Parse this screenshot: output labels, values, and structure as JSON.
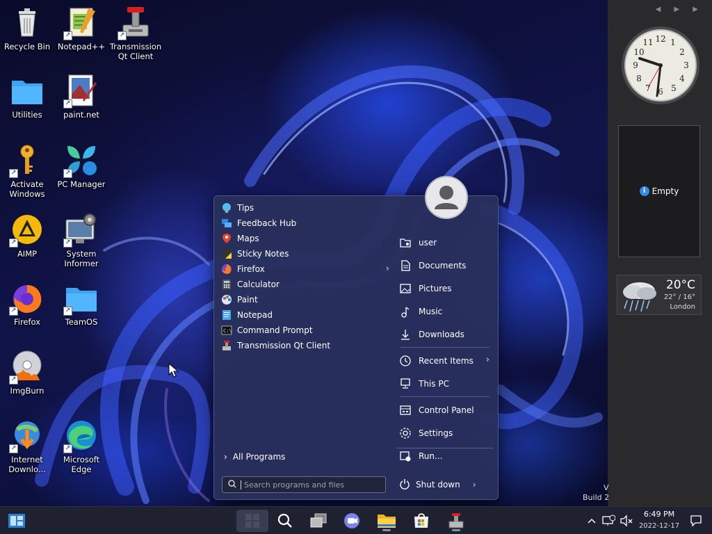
{
  "desktop_icons": [
    {
      "id": "recycle-bin",
      "label": "Recycle Bin",
      "shortcut": false
    },
    {
      "id": "notepadpp",
      "label": "Notepad++",
      "shortcut": true
    },
    {
      "id": "transmission",
      "label": "Transmission\nQt Client",
      "shortcut": true
    },
    {
      "id": "utilities",
      "label": "Utilities",
      "shortcut": false
    },
    {
      "id": "paintnet",
      "label": "paint.net",
      "shortcut": true
    },
    {
      "id": "activate-windows",
      "label": "Activate\nWindows",
      "shortcut": true
    },
    {
      "id": "pc-manager",
      "label": "PC Manager",
      "shortcut": true
    },
    {
      "id": "aimp",
      "label": "AIMP",
      "shortcut": true
    },
    {
      "id": "system-informer",
      "label": "System\nInformer",
      "shortcut": true
    },
    {
      "id": "firefox",
      "label": "Firefox",
      "shortcut": true
    },
    {
      "id": "teamos",
      "label": "TeamOS",
      "shortcut": true
    },
    {
      "id": "imgburn",
      "label": "ImgBurn",
      "shortcut": true
    },
    {
      "id": "internet-download",
      "label": "Internet\nDownlo...",
      "shortcut": true
    },
    {
      "id": "microsoft-edge",
      "label": "Microsoft\nEdge",
      "shortcut": true
    }
  ],
  "start_menu": {
    "programs": [
      {
        "label": "Tips",
        "icon": "tips-icon",
        "submenu": false
      },
      {
        "label": "Feedback Hub",
        "icon": "feedback-hub-icon",
        "submenu": false
      },
      {
        "label": "Maps",
        "icon": "maps-icon",
        "submenu": false
      },
      {
        "label": "Sticky Notes",
        "icon": "sticky-notes-icon",
        "submenu": false
      },
      {
        "label": "Firefox",
        "icon": "firefox-icon",
        "submenu": true
      },
      {
        "label": "Calculator",
        "icon": "calculator-icon",
        "submenu": false
      },
      {
        "label": "Paint",
        "icon": "paint-icon",
        "submenu": false
      },
      {
        "label": "Notepad",
        "icon": "notepad-icon",
        "submenu": false
      },
      {
        "label": "Command Prompt",
        "icon": "command-prompt-icon",
        "submenu": false
      },
      {
        "label": "Transmission Qt Client",
        "icon": "transmission-icon",
        "submenu": false
      }
    ],
    "all_programs_label": "All Programs",
    "search_placeholder": "Search programs and files",
    "right_items": [
      {
        "label": "user",
        "icon": "user-folder-icon",
        "submenu": false
      },
      {
        "label": "Documents",
        "icon": "documents-icon",
        "submenu": false
      },
      {
        "label": "Pictures",
        "icon": "pictures-icon",
        "submenu": false
      },
      {
        "label": "Music",
        "icon": "music-icon",
        "submenu": false
      },
      {
        "label": "Downloads",
        "icon": "downloads-icon",
        "submenu": false
      },
      {
        "label": "Recent Items",
        "icon": "recent-items-icon",
        "submenu": true
      },
      {
        "label": "This PC",
        "icon": "this-pc-icon",
        "submenu": false
      },
      {
        "label": "Control Panel",
        "icon": "control-panel-icon",
        "submenu": false
      },
      {
        "label": "Settings",
        "icon": "settings-icon",
        "submenu": false
      },
      {
        "label": "Run...",
        "icon": "run-icon",
        "submenu": false
      }
    ],
    "shutdown_label": "Shut down"
  },
  "sidebar": {
    "empty_label": "Empty",
    "weather": {
      "temp": "20°C",
      "range": "22° / 16°",
      "city": "London"
    }
  },
  "build_text": "Build 2",
  "build_v": "V",
  "taskbar": {
    "time": "6:49 PM",
    "date": "2022-12-17"
  },
  "colors": {
    "menu_bg": "#28305c",
    "taskbar_bg": "#1f2130",
    "sidebar_bg": "#2a2a2c",
    "accent": "#2f8be6"
  }
}
